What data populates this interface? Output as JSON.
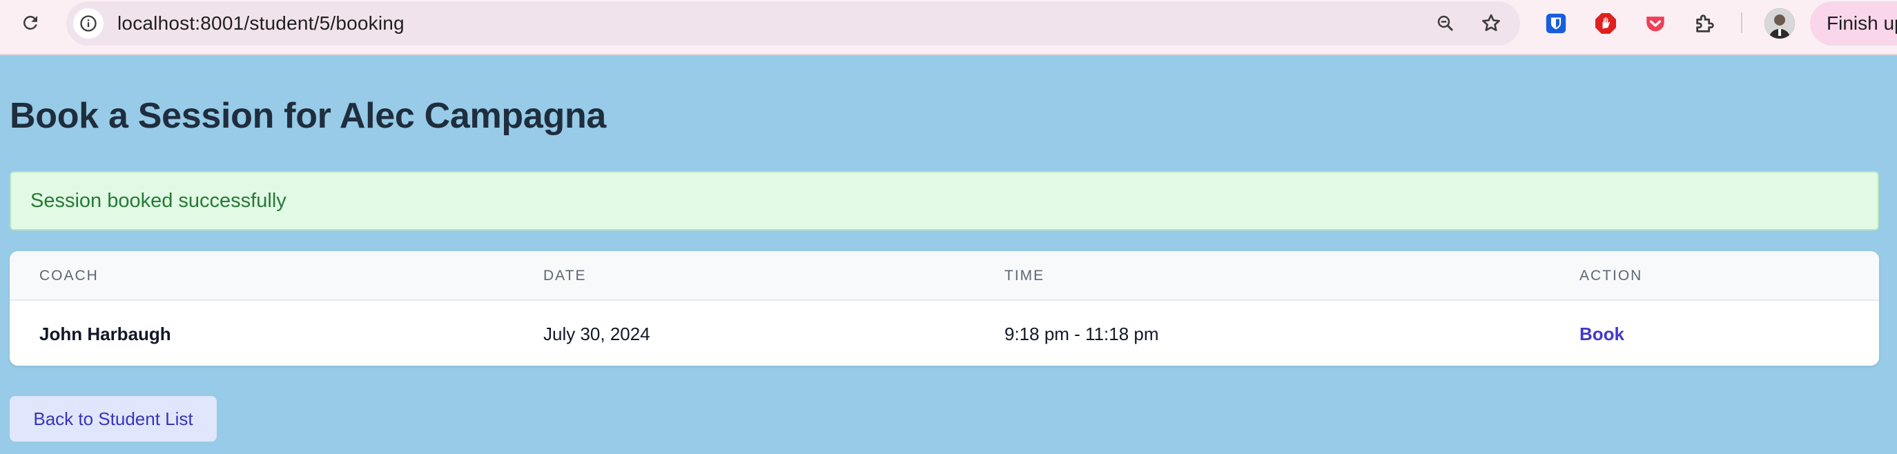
{
  "browser": {
    "url": "localhost:8001/student/5/booking",
    "finish_label": "Finish up",
    "icons": {
      "reload": "reload-icon",
      "site_info": "info-icon",
      "zoom": "zoom-icon",
      "bookmark": "star-icon",
      "bitwarden": "bitwarden-icon",
      "adblock": "adblock-icon",
      "pocket": "pocket-icon",
      "extensions": "puzzle-icon",
      "profile": "avatar"
    }
  },
  "page": {
    "title": "Book a Session for Alec Campagna",
    "alert": "Session booked successfully",
    "table": {
      "headers": [
        "COACH",
        "DATE",
        "TIME",
        "ACTION"
      ],
      "rows": [
        {
          "coach": "John Harbaugh",
          "date": "July 30, 2024",
          "time": "9:18 pm - 11:18 pm",
          "action": "Book"
        }
      ]
    },
    "back_button": "Back to Student List"
  },
  "colors": {
    "page_bg": "#97cbe7",
    "alert_bg": "#e1f9e5",
    "alert_text": "#267a35",
    "link": "#4338ca",
    "button_bg": "#e0e6fb"
  }
}
